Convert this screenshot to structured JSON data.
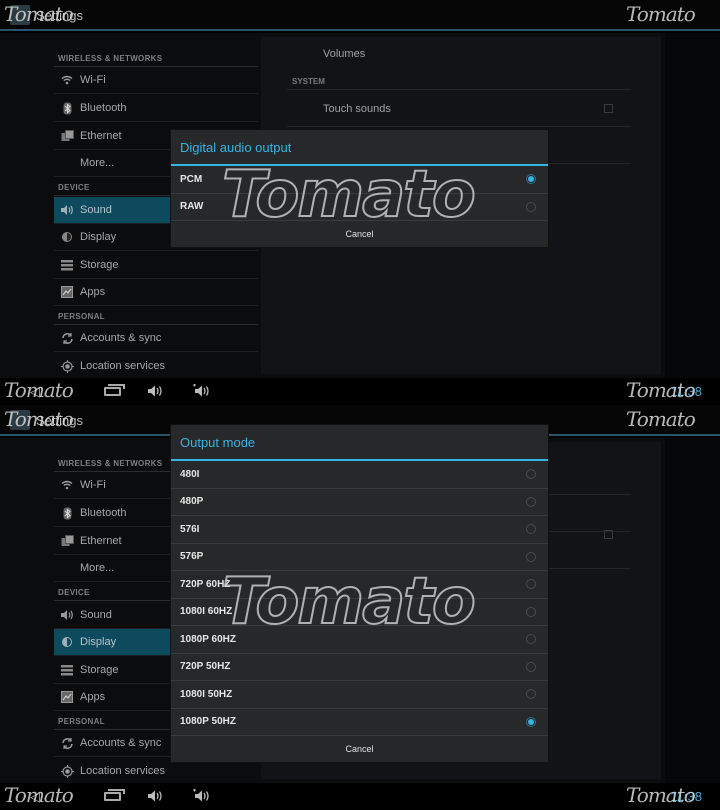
{
  "watermark": "Tomato",
  "screens": [
    {
      "app_title": "Settings",
      "sidebar": {
        "sections": [
          {
            "header": "WIRELESS & NETWORKS"
          },
          {
            "header": "DEVICE"
          },
          {
            "header": "PERSONAL"
          }
        ],
        "items": [
          {
            "label": "Wi-Fi",
            "icon": "wifi-icon"
          },
          {
            "label": "Bluetooth",
            "icon": "bluetooth-icon"
          },
          {
            "label": "Ethernet",
            "icon": "ethernet-icon"
          },
          {
            "label": "More...",
            "icon": ""
          },
          {
            "label": "Sound",
            "icon": "sound-icon"
          },
          {
            "label": "Display",
            "icon": "display-icon"
          },
          {
            "label": "Storage",
            "icon": "storage-icon"
          },
          {
            "label": "Apps",
            "icon": "apps-icon"
          },
          {
            "label": "Accounts & sync",
            "icon": "sync-icon"
          },
          {
            "label": "Location services",
            "icon": "location-icon"
          }
        ],
        "active": "Sound"
      },
      "right_pane": {
        "volumes_label": "Volumes",
        "system_header": "SYSTEM",
        "touch_sounds_label": "Touch sounds",
        "touch_sounds_checked": false
      },
      "dialog": {
        "title": "Digital audio output",
        "options": [
          {
            "label": "PCM",
            "selected": true
          },
          {
            "label": "RAW",
            "selected": false
          }
        ],
        "cancel_label": "Cancel"
      }
    },
    {
      "app_title": "Settings",
      "sidebar": {
        "active": "Display"
      },
      "dialog": {
        "title": "Output mode",
        "options": [
          {
            "label": "480I",
            "selected": false
          },
          {
            "label": "480P",
            "selected": false
          },
          {
            "label": "576I",
            "selected": false
          },
          {
            "label": "576P",
            "selected": false
          },
          {
            "label": "720P 60HZ",
            "selected": false
          },
          {
            "label": "1080I 60HZ",
            "selected": false
          },
          {
            "label": "1080P 60HZ",
            "selected": false
          },
          {
            "label": "720P 50HZ",
            "selected": false
          },
          {
            "label": "1080I 50HZ",
            "selected": false
          },
          {
            "label": "1080P 50HZ",
            "selected": true
          }
        ],
        "cancel_label": "Cancel"
      }
    }
  ],
  "system_bar": {
    "clock": "11:38",
    "accent_color": "#33b5e5"
  }
}
